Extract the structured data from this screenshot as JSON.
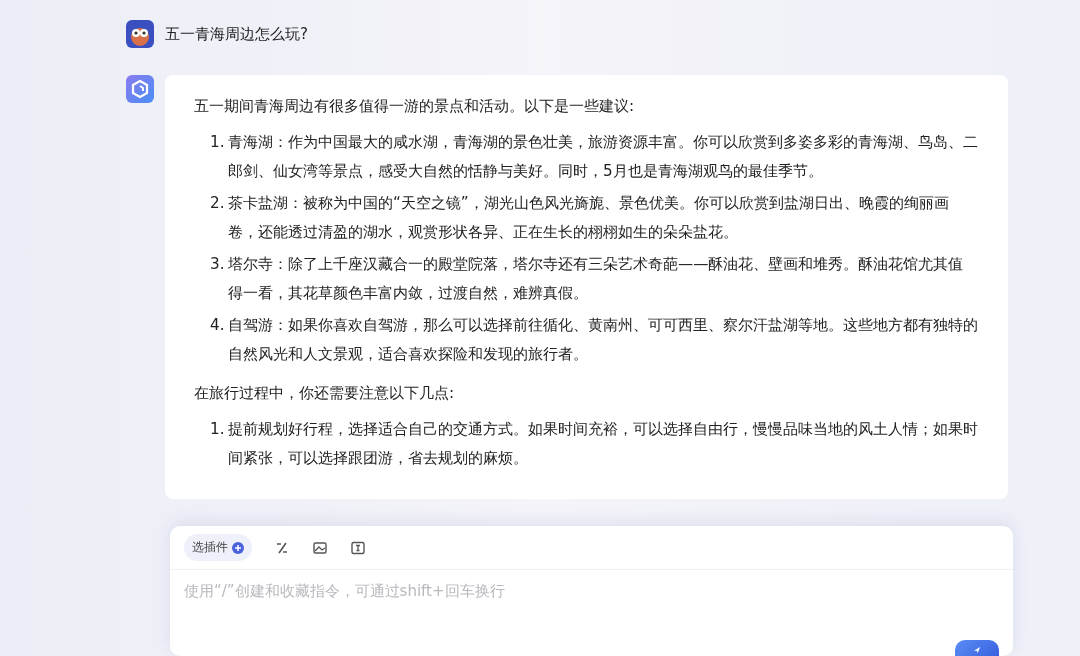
{
  "question": {
    "text": "五一青海周边怎么玩?"
  },
  "answer": {
    "intro": "五一期间青海周边有很多值得一游的景点和活动。以下是一些建议:",
    "attractions": [
      {
        "number": "1.",
        "text": "青海湖：作为中国最大的咸水湖，青海湖的景色壮美，旅游资源丰富。你可以欣赏到多姿多彩的青海湖、鸟岛、二郎剑、仙女湾等景点，感受大自然的恬静与美好。同时，5月也是青海湖观鸟的最佳季节。"
      },
      {
        "number": "2.",
        "text": "茶卡盐湖：被称为中国的“天空之镜”，湖光山色风光旖旎、景色优美。你可以欣赏到盐湖日出、晚霞的绚丽画卷，还能透过清盈的湖水，观赏形状各异、正在生长的栩栩如生的朵朵盐花。"
      },
      {
        "number": "3.",
        "text": "塔尔寺：除了上千座汉藏合一的殿堂院落，塔尔寺还有三朵艺术奇葩——酥油花、壁画和堆秀。酥油花馆尤其值得一看，其花草颜色丰富内敛，过渡自然，难辨真假。"
      },
      {
        "number": "4.",
        "text": "自驾游：如果你喜欢自驾游，那么可以选择前往循化、黄南州、可可西里、察尔汗盐湖等地。这些地方都有独特的自然风光和人文景观，适合喜欢探险和发现的旅行者。"
      }
    ],
    "tips_intro": "在旅行过程中，你还需要注意以下几点:",
    "tips": [
      {
        "number": "1.",
        "text": "提前规划好行程，选择适合自己的交通方式。如果时间充裕，可以选择自由行，慢慢品味当地的风土人情；如果时间紧张，可以选择跟团游，省去规划的麻烦。"
      }
    ]
  },
  "composer": {
    "plugin_button": "选插件",
    "placeholder": "使用“/”创建和收藏指令，可通过shift+回车换行"
  }
}
